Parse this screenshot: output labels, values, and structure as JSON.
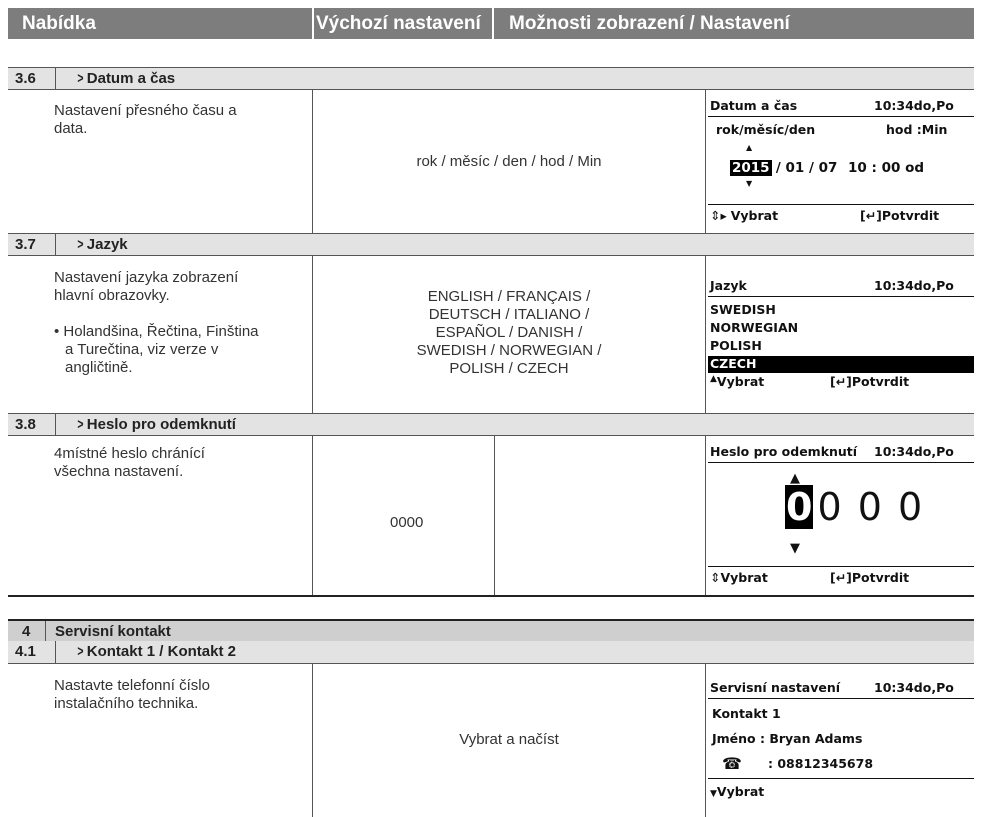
{
  "header": {
    "col1": "Nabídka",
    "col2": "Výchozí nastavení",
    "col3": "Možnosti zobrazení / Nastavení"
  },
  "s36": {
    "num": "3.6",
    "title": "Datum a čas",
    "desc1": "Nastavení přesného času a",
    "desc2": "data.",
    "default": "rok / měsíc / den / hod / Min",
    "lcd": {
      "title": "Datum a čas",
      "time": "10:34do,Po",
      "labels": "rok/měsíc/den",
      "labels2": "hod  :Min",
      "year": "2015",
      "date_rest": "/ 01 / 07",
      "clock": "10 : 00  od",
      "select": "Vybrat",
      "confirm": "[↵]Potvrdit"
    }
  },
  "s37": {
    "num": "3.7",
    "title": "Jazyk",
    "desc1": "Nastavení jazyka zobrazení",
    "desc2": "hlavní obrazovky.",
    "bullet1": "• Holandšina, Řečtina, Finština",
    "bullet2": "a Turečtina, viz verze v",
    "bullet3": "angličtině.",
    "default1": "ENGLISH / FRANÇAIS /",
    "default2": "DEUTSCH / ITALIANO /",
    "default3": "ESPAÑOL / DANISH /",
    "default4": "SWEDISH / NORWEGIAN /",
    "default5": "POLISH / CZECH",
    "lcd": {
      "title": "Jazyk",
      "time": "10:34do,Po",
      "items": [
        "SWEDISH",
        "NORWEGIAN",
        "POLISH",
        "CZECH"
      ],
      "select": "Vybrat",
      "confirm": "[↵]Potvrdit"
    }
  },
  "s38": {
    "num": "3.8",
    "title": "Heslo pro odemknutí",
    "desc1": "4místné heslo chránící",
    "desc2": "všechna nastavení.",
    "default": "0000",
    "lcd": {
      "title": "Heslo pro odemknutí",
      "time": "10:34do,Po",
      "digit1": "0",
      "digits": "0 0 0",
      "select": "Vybrat",
      "confirm": "[↵]Potvrdit"
    }
  },
  "s4": {
    "num": "4",
    "title": "Servisní kontakt"
  },
  "s41": {
    "num": "4.1",
    "title": "Kontakt 1 / Kontakt 2",
    "desc1": "Nastavte telefonní číslo",
    "desc2": "instalačního technika.",
    "default": "Vybrat a načíst",
    "lcd": {
      "title": "Servisní nastavení",
      "time": "10:34do,Po",
      "contact": "Kontakt 1",
      "name_label": "Jméno  :  Bryan Adams",
      "phone": ":  08812345678",
      "select": "Vybrat"
    }
  }
}
